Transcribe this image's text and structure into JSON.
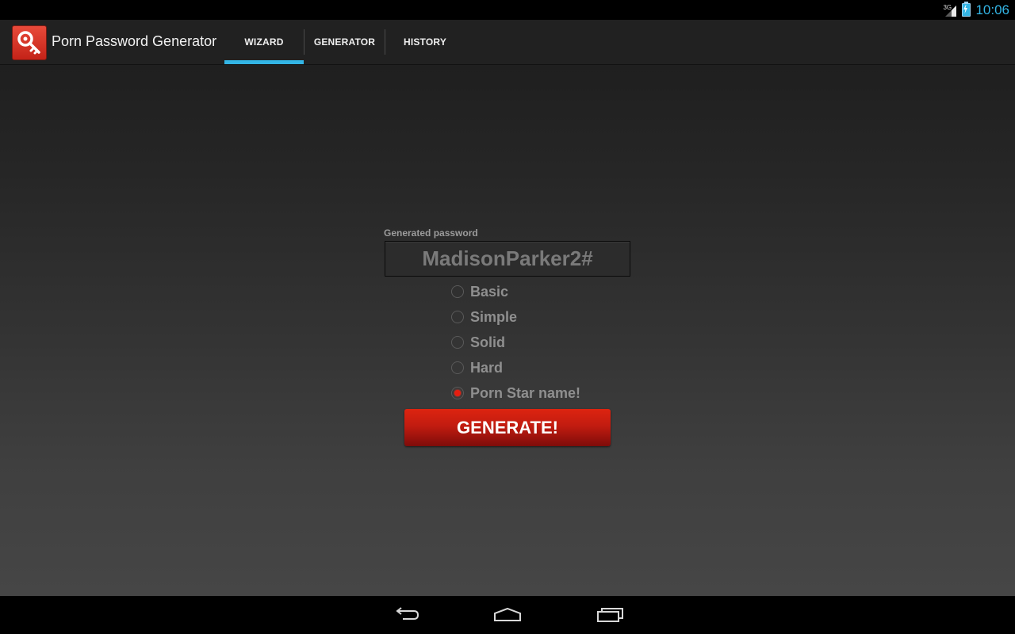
{
  "status_bar": {
    "network": "3G",
    "time": "10:06",
    "icons": [
      "signal-icon",
      "battery-icon"
    ],
    "clock_color": "#33b5e5"
  },
  "action_bar": {
    "app_icon": "key-icon",
    "title": "Porn Password Generator",
    "tabs": [
      {
        "label": "WIZARD",
        "selected": true
      },
      {
        "label": "GENERATOR",
        "selected": false
      },
      {
        "label": "HISTORY",
        "selected": false
      }
    ],
    "accent_color": "#33b5e5"
  },
  "main": {
    "password_label": "Generated password",
    "password_value": "MadisonParker2#",
    "options": [
      {
        "label": "Basic",
        "selected": false
      },
      {
        "label": "Simple",
        "selected": false
      },
      {
        "label": "Solid",
        "selected": false
      },
      {
        "label": "Hard",
        "selected": false
      },
      {
        "label": "Porn Star name!",
        "selected": true
      }
    ],
    "generate_label": "GENERATE!",
    "button_color": "#c21c10"
  },
  "nav_bar": {
    "buttons": [
      "back-icon",
      "home-icon",
      "recent-apps-icon"
    ]
  }
}
